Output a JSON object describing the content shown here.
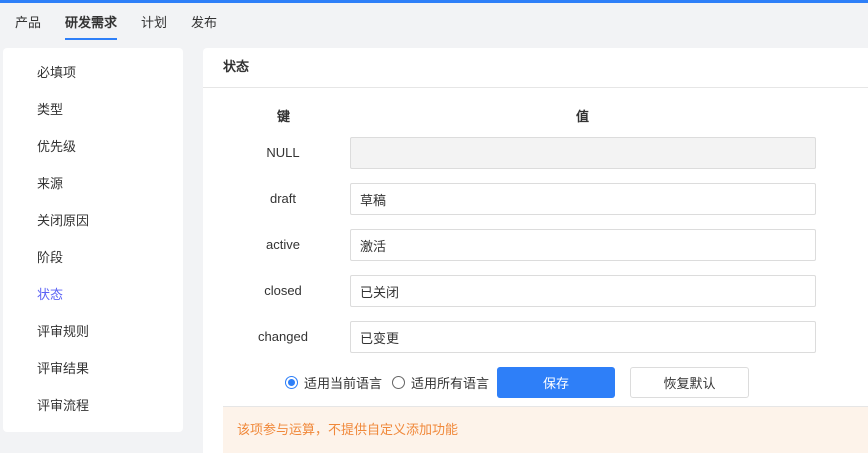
{
  "nav": {
    "tabs": [
      {
        "label": "产品"
      },
      {
        "label": "研发需求",
        "active": true
      },
      {
        "label": "计划"
      },
      {
        "label": "发布"
      }
    ]
  },
  "sidebar": {
    "items": [
      {
        "label": "必填项"
      },
      {
        "label": "类型"
      },
      {
        "label": "优先级"
      },
      {
        "label": "来源"
      },
      {
        "label": "关闭原因"
      },
      {
        "label": "阶段"
      },
      {
        "label": "状态",
        "active": true
      },
      {
        "label": "评审规则"
      },
      {
        "label": "评审结果"
      },
      {
        "label": "评审流程"
      }
    ]
  },
  "main": {
    "title": "状态",
    "key_header": "键",
    "value_header": "值",
    "rows": [
      {
        "key": "NULL",
        "value": ""
      },
      {
        "key": "draft",
        "value": "草稿"
      },
      {
        "key": "active",
        "value": "激活"
      },
      {
        "key": "closed",
        "value": "已关闭"
      },
      {
        "key": "changed",
        "value": "已变更"
      }
    ],
    "radio_current": "适用当前语言",
    "radio_all": "适用所有语言",
    "radio_selected": "current",
    "save_label": "保存",
    "reset_label": "恢复默认",
    "notice": "该项参与运算，不提供自定义添加功能"
  },
  "colors": {
    "accent": "#2e7ff8",
    "active_side": "#5a61f5",
    "warning": "#f0883a"
  }
}
